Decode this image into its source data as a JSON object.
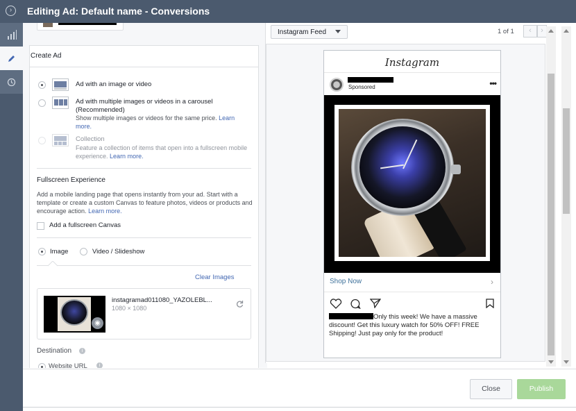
{
  "window": {
    "title": "Editing Ad: Default name - Conversions"
  },
  "create_ad": {
    "title": "Create Ad",
    "formats": [
      {
        "label": "Ad with an image or video",
        "selected": true
      },
      {
        "label": "Ad with multiple images or videos in a carousel",
        "sub": "(Recommended)",
        "desc": "Show multiple images or videos for the same price.",
        "link": "Learn more.",
        "selected": false
      },
      {
        "label": "Collection",
        "desc": "Feature a collection of items that open into a fullscreen mobile experience.",
        "link": "Learn more.",
        "selected": false,
        "disabled": true
      }
    ]
  },
  "fullscreen": {
    "title": "Fullscreen Experience",
    "desc": "Add a mobile landing page that opens instantly from your ad. Start with a template or create a custom Canvas to feature photos, videos or products and encourage action.",
    "link": "Learn more.",
    "checkbox_label": "Add a fullscreen Canvas"
  },
  "media": {
    "tab_image": "Image",
    "tab_video": "Video / Slideshow",
    "clear_label": "Clear Images",
    "file_name": "instagramad011080_YAZOLEBL...",
    "file_dims": "1080 × 1080"
  },
  "destination": {
    "title": "Destination",
    "website_label": "Website URL"
  },
  "preview": {
    "placement": "Instagram Feed",
    "pager": "1 of 1",
    "ig_logo": "Instagram",
    "sponsored": "Sponsored",
    "more": "•••",
    "cta": "Shop Now",
    "caption": "Only this week! We have a massive discount! Get this luxury watch for 50% OFF! FREE Shipping! Just pay only for the product!"
  },
  "footer": {
    "close_label": "Close",
    "publish_label": "Publish"
  },
  "colors": {
    "topbar": "#4b5a6e",
    "link": "#4267b2",
    "publish_disabled": "#a9d89a",
    "ig_link": "#3f729b"
  }
}
